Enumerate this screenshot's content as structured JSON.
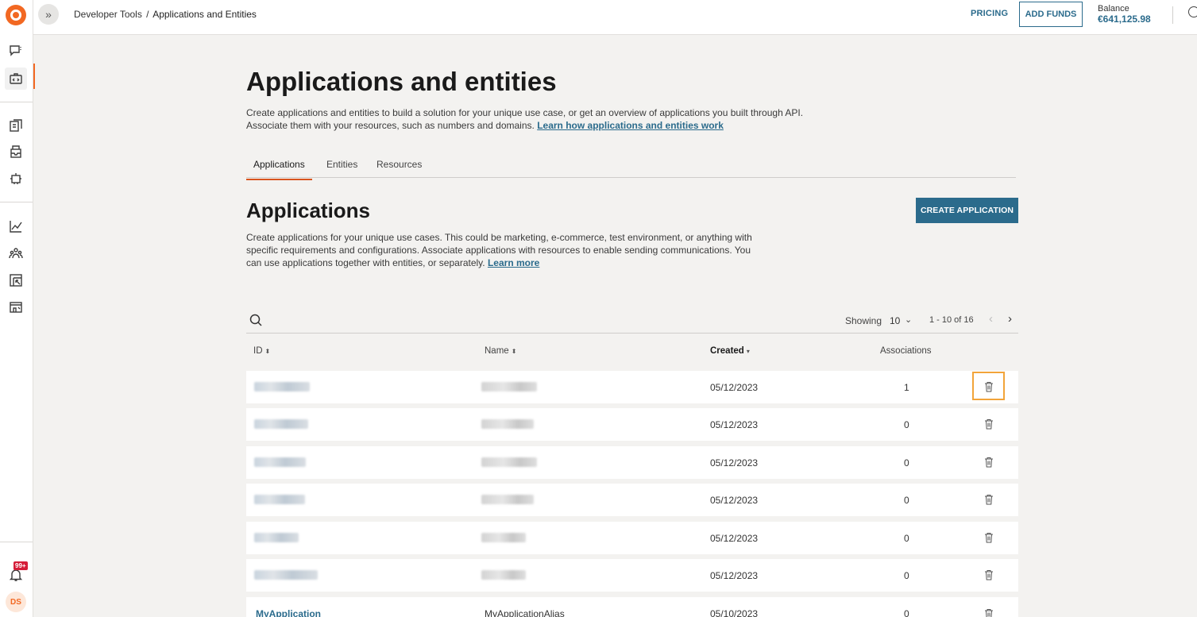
{
  "topbar": {
    "breadcrumb_parent": "Developer Tools",
    "breadcrumb_separator": "/",
    "breadcrumb_current": "Applications and Entities",
    "pricing_label": "PRICING",
    "add_funds_label": "ADD FUNDS",
    "balance_label": "Balance",
    "balance_value": "€641,125.98"
  },
  "rail": {
    "notification_badge": "99+",
    "avatar_initials": "DS"
  },
  "page": {
    "title": "Applications and entities",
    "description": "Create applications and entities to build a solution for your unique use case, or get an overview of applications you built through API. Associate them with your resources, such as numbers and domains.",
    "learn_link": "Learn how applications and entities work"
  },
  "tabs": [
    {
      "label": "Applications",
      "active": true
    },
    {
      "label": "Entities",
      "active": false
    },
    {
      "label": "Resources",
      "active": false
    }
  ],
  "section": {
    "title": "Applications",
    "create_button": "CREATE APPLICATION",
    "description": "Create applications for your unique use cases. This could be marketing, e-commerce, test environment, or anything with specific requirements and configurations. Associate applications with resources to enable sending communications. You can use applications together with entities, or separately.",
    "learn_more": "Learn more"
  },
  "table": {
    "showing_label": "Showing",
    "page_size": "10",
    "range": "1 - 10 of 16",
    "columns": [
      "ID",
      "Name",
      "Created",
      "Associations"
    ],
    "rows": [
      {
        "id": "",
        "name": "",
        "created": "05/12/2023",
        "associations": "1"
      },
      {
        "id": "",
        "name": "",
        "created": "05/12/2023",
        "associations": "0"
      },
      {
        "id": "",
        "name": "",
        "created": "05/12/2023",
        "associations": "0"
      },
      {
        "id": "",
        "name": "",
        "created": "05/12/2023",
        "associations": "0"
      },
      {
        "id": "",
        "name": "",
        "created": "05/12/2023",
        "associations": "0"
      },
      {
        "id": "",
        "name": "",
        "created": "05/12/2023",
        "associations": "0"
      },
      {
        "id": "MyApplication",
        "name": "MyApplicationAlias",
        "created": "05/10/2023",
        "associations": "0"
      }
    ]
  },
  "colors": {
    "brand_orange": "#f26822",
    "accent_blue": "#2b6b8c",
    "focus_outline": "#f2a43a"
  }
}
